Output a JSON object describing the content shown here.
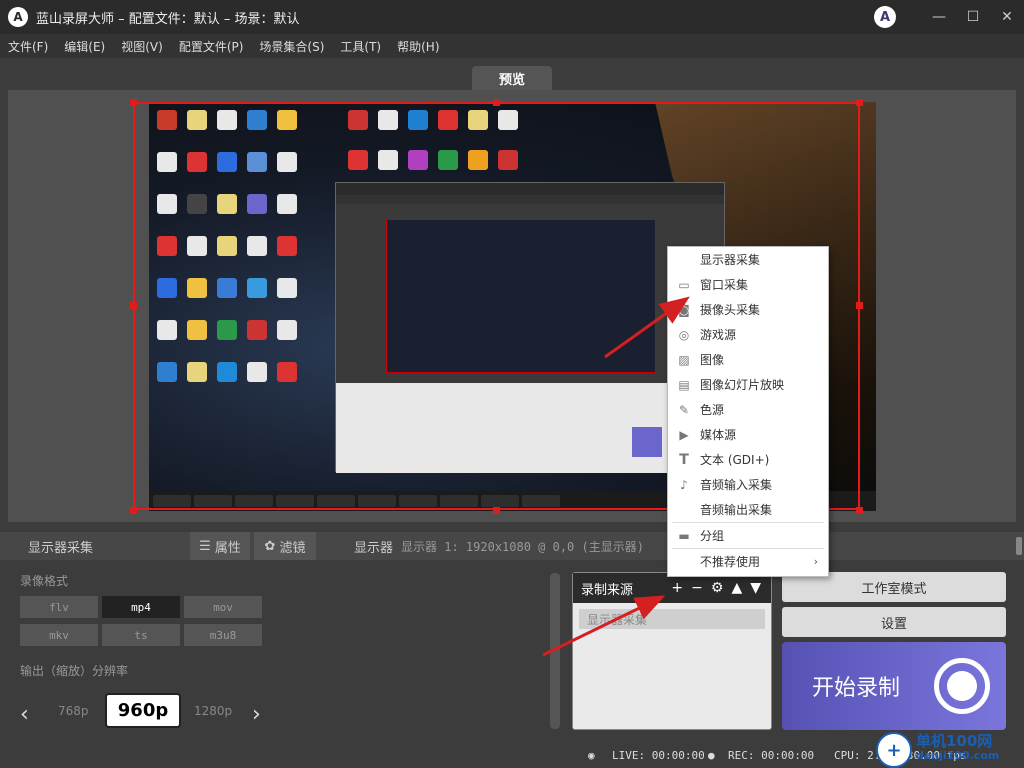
{
  "titlebar": {
    "app_name": "蓝山录屏大师",
    "subtitle": " – 配置文件：默认 – 场景：默认",
    "logo_letter": "A",
    "brand_letter": "A",
    "minimize": "—",
    "maximize": "☐",
    "close": "✕"
  },
  "menubar": {
    "items": [
      "文件(F)",
      "编辑(E)",
      "视图(V)",
      "配置文件(P)",
      "场景集合(S)",
      "工具(T)",
      "帮助(H)"
    ]
  },
  "preview": {
    "tab_label": "预览"
  },
  "controls": {
    "source_name": "显示器采集",
    "properties_label": "属性",
    "filters_label": "滤镜",
    "display_label": "显示器",
    "display_value": "显示器 1: 1920x1080 @ 0,0 (主显示器)"
  },
  "record_format": {
    "label": "录像格式",
    "formats": [
      "flv",
      "mp4",
      "mov",
      "mkv",
      "ts",
      "m3u8"
    ],
    "selected": "mp4"
  },
  "resolution": {
    "label": "输出（缩放）分辨率",
    "prev": "‹",
    "next": "›",
    "left_option": "768p",
    "selected": "960p",
    "right_option": "1280p"
  },
  "sources": {
    "title": "录制来源",
    "add": "+",
    "remove": "−",
    "settings": "⚙",
    "up": "▲",
    "down": "▼",
    "items": [
      "显示器采集"
    ]
  },
  "right_panel": {
    "studio_mode": "工作室模式",
    "settings": "设置",
    "start_recording": "开始录制"
  },
  "status": {
    "live": "LIVE: 00:00:00",
    "rec": "REC: 00:00:00",
    "cpu": "CPU: 2.0%, 30.00 fps"
  },
  "context_menu": {
    "items": [
      {
        "label": "显示器采集",
        "icon": "none"
      },
      {
        "label": "窗口采集",
        "icon": "window-icon"
      },
      {
        "label": "摄像头采集",
        "icon": "camera-icon"
      },
      {
        "label": "游戏源",
        "icon": "gamepad-icon"
      },
      {
        "label": "图像",
        "icon": "image-icon"
      },
      {
        "label": "图像幻灯片放映",
        "icon": "slideshow-icon"
      },
      {
        "label": "色源",
        "icon": "paint-brush-icon"
      },
      {
        "label": "媒体源",
        "icon": "play-icon"
      },
      {
        "label": "文本 (GDI+)",
        "icon": "text-icon"
      },
      {
        "label": "音频输入采集",
        "icon": "microphone-icon"
      },
      {
        "label": "音频输出采集",
        "icon": "none"
      },
      {
        "label": "分组",
        "icon": "folder-icon"
      },
      {
        "label": "不推荐使用",
        "icon": "none",
        "submenu_arrow": "›"
      }
    ]
  },
  "watermark": {
    "line1": "单机100网",
    "line2": "danji100.com",
    "symbol": "+"
  },
  "colors": {
    "selection_red": "#e21b1b",
    "record_purple": "#6a66cc",
    "arrow_red": "#d42020"
  }
}
